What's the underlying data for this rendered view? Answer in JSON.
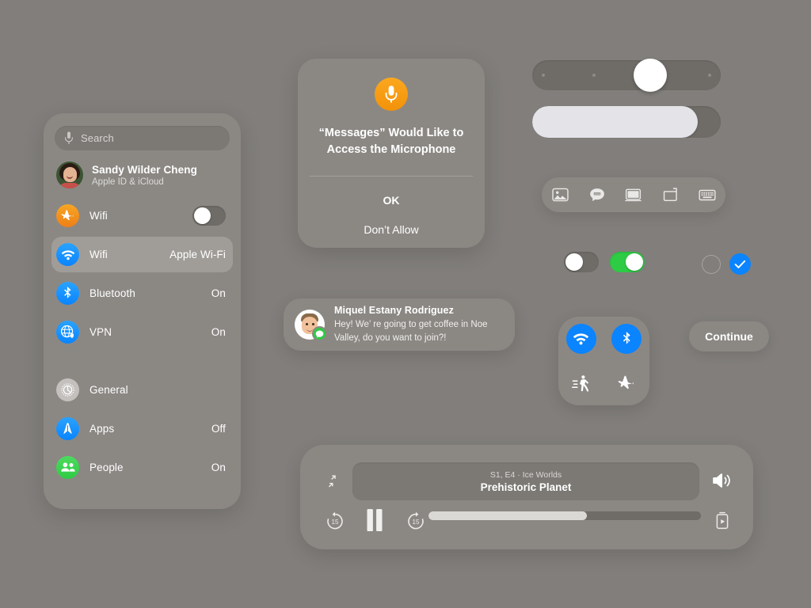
{
  "theme": {
    "background": "#817e7b",
    "panel": "#8b8884",
    "panel_inset": "#7c7975",
    "selected_row": "#a09d99",
    "accent_blue": "#0a84ff",
    "accent_green": "#2ecb44",
    "accent_orange": "#f29209",
    "text_primary": "#ffffff",
    "text_secondary": "#dddbd8"
  },
  "settings": {
    "search": {
      "placeholder": "Search",
      "icon": "microphone-icon"
    },
    "account": {
      "name": "Sandy Wilder Cheng",
      "subtitle": "Apple ID & iCloud",
      "avatar": "photo-avatar"
    },
    "rows": [
      {
        "label": "Wifi",
        "value": "",
        "icon": "airplane-icon",
        "control": "toggle",
        "toggle_on": false,
        "selected": false
      },
      {
        "label": "Wifi",
        "value": "Apple Wi-Fi",
        "icon": "wifi-icon",
        "control": "value",
        "selected": true
      },
      {
        "label": "Bluetooth",
        "value": "On",
        "icon": "bluetooth-icon",
        "control": "value",
        "selected": false
      },
      {
        "label": "VPN",
        "value": "On",
        "icon": "vpn-globe-icon",
        "control": "value",
        "selected": false
      },
      {
        "label": "General",
        "value": "",
        "icon": "gear-icon",
        "control": "value",
        "selected": false
      },
      {
        "label": "Apps",
        "value": "Off",
        "icon": "apps-icon",
        "control": "value",
        "selected": false
      },
      {
        "label": "People",
        "value": "On",
        "icon": "people-icon",
        "control": "value",
        "selected": false
      }
    ]
  },
  "alert": {
    "icon": "microphone-icon",
    "title": "“Messages” Would Like to Access the Microphone",
    "primary_button": "OK",
    "secondary_button": "Don’t Allow"
  },
  "notification": {
    "sender": "Miquel Estany Rodriguez",
    "message": "Hey! We’ re going to get coffee in Noe Valley, do you want to join?!",
    "avatar": "memoji-avatar",
    "badge": "messages-icon"
  },
  "sliders": {
    "stepped": {
      "value_percent": 62,
      "ticks": [
        5,
        32,
        95
      ]
    },
    "filled": {
      "value_percent": 88
    }
  },
  "toolbar": {
    "items": [
      {
        "icon": "photos-icon"
      },
      {
        "icon": "sticker-message-icon"
      },
      {
        "icon": "display-icon"
      },
      {
        "icon": "share-up-icon"
      },
      {
        "icon": "keyboard-icon"
      }
    ]
  },
  "controls": {
    "toggle_off": {
      "on": false
    },
    "toggle_on": {
      "on": true
    },
    "radio_unchecked": {
      "checked": false
    },
    "radio_checked": {
      "checked": true,
      "icon": "checkmark-icon"
    }
  },
  "control_center": {
    "buttons": [
      {
        "icon": "wifi-icon",
        "active": true
      },
      {
        "icon": "bluetooth-icon",
        "active": true
      },
      {
        "icon": "airdrop-walk-icon",
        "active": false
      },
      {
        "icon": "airplane-icon",
        "active": false
      }
    ]
  },
  "continue_button": {
    "label": "Continue"
  },
  "player": {
    "episode": "S1, E4 · Ice Worlds",
    "title": "Prehistoric Planet",
    "minimize_icon": "minimize-icon",
    "volume_icon": "volume-icon",
    "skip_back_icon": "back-15-icon",
    "skip_back_label": "15",
    "play_state_icon": "pause-icon",
    "skip_forward_icon": "forward-15-icon",
    "skip_forward_label": "15",
    "airplay_icon": "airplay-video-icon",
    "progress_percent": 58
  }
}
